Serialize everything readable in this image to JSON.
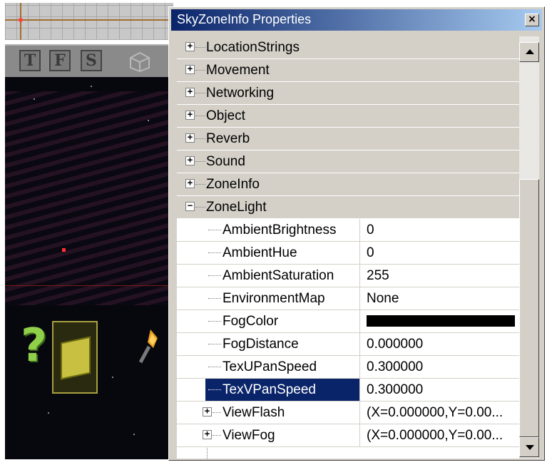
{
  "window": {
    "title": "SkyZoneInfo Properties",
    "close_label": "×"
  },
  "viewport_toolbar": {
    "buttons": [
      "T",
      "F",
      "S"
    ]
  },
  "properties": {
    "categories_collapsed": [
      "LocationStrings",
      "Movement",
      "Networking",
      "Object",
      "Reverb",
      "Sound",
      "ZoneInfo"
    ],
    "expanded_category": "ZoneLight",
    "zonelight_props": [
      {
        "name": "AmbientBrightness",
        "value": "0"
      },
      {
        "name": "AmbientHue",
        "value": "0"
      },
      {
        "name": "AmbientSaturation",
        "value": "255"
      },
      {
        "name": "EnvironmentMap",
        "value": "None"
      },
      {
        "name": "FogColor",
        "value": ""
      },
      {
        "name": "FogDistance",
        "value": "0.000000"
      },
      {
        "name": "TexUPanSpeed",
        "value": "0.300000"
      },
      {
        "name": "TexVPanSpeed",
        "value": "0.300000"
      }
    ],
    "sub_structs": [
      {
        "name": "ViewFlash",
        "value": "(X=0.000000,Y=0.00..."
      },
      {
        "name": "ViewFog",
        "value": "(X=0.000000,Y=0.00..."
      }
    ],
    "selected_property": "TexVPanSpeed",
    "fog_color_hex": "#000000"
  },
  "colors": {
    "titlebar_start": "#0a246a",
    "titlebar_end": "#a6caf0",
    "selection": "#0a246a",
    "panel": "#d4d0c8"
  },
  "icons": {
    "expand": "plus-box-icon",
    "collapse": "minus-box-icon",
    "scroll_up": "arrow-up-icon",
    "scroll_down": "arrow-down-icon"
  }
}
